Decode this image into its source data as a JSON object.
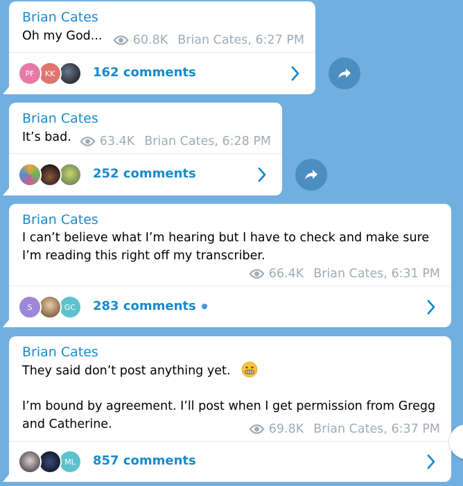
{
  "colors": {
    "background": "#71afe0",
    "accent": "#168acd",
    "meta": "#a0acb6"
  },
  "messages": [
    {
      "sender": "Brian Cates",
      "lines": [
        "Oh my God..."
      ],
      "views": "60.8K",
      "signature": "Brian Cates, 6:27 PM",
      "comments": "162 comments",
      "avatars": [
        "PF",
        "KK",
        ""
      ]
    },
    {
      "sender": "Brian Cates",
      "lines": [
        "It’s bad."
      ],
      "views": "63.4K",
      "signature": "Brian Cates, 6:28 PM",
      "comments": "252 comments",
      "avatars": [
        "",
        "",
        ""
      ]
    },
    {
      "sender": "Brian Cates",
      "lines": [
        "I can’t believe what I’m hearing but I have to check and make sure",
        "I’m reading this right off my transcriber."
      ],
      "views": "66.4K",
      "signature": "Brian Cates, 6:31 PM",
      "comments": "283 comments",
      "avatars": [
        "S",
        "",
        "GC"
      ]
    },
    {
      "sender": "Brian Cates",
      "lines": [
        "They said don’t post anything yet.",
        "I’m bound by agreement. I’ll post when I get permission from Gregg",
        "and Catherine."
      ],
      "views": "69.8K",
      "signature": "Brian Cates, 6:37 PM",
      "comments": "857 comments",
      "avatars": [
        "",
        "",
        "ML"
      ]
    }
  ],
  "icons": {
    "views": "eye-icon",
    "share": "share-icon",
    "chevron": "chevron-right-icon",
    "emoji": "grimacing-face-emoji"
  }
}
